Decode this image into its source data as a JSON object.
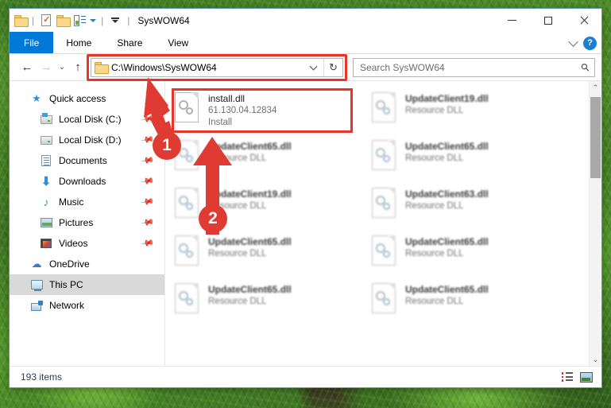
{
  "window": {
    "title": "SysWOW64",
    "quick_access_toolbar": [
      {
        "name": "folder-icon",
        "label": ""
      },
      {
        "name": "properties-icon",
        "label": ""
      },
      {
        "name": "new-folder-icon",
        "label": ""
      },
      {
        "name": "customize-quick-access-icon",
        "label": ""
      },
      {
        "name": "minimize-ribbon-icon",
        "label": ""
      }
    ],
    "controls": {
      "minimize": "Minimize",
      "maximize": "Maximize",
      "close": "Close"
    }
  },
  "ribbon": {
    "tabs": [
      {
        "id": "file",
        "label": "File",
        "active": true
      },
      {
        "id": "home",
        "label": "Home",
        "active": false
      },
      {
        "id": "share",
        "label": "Share",
        "active": false
      },
      {
        "id": "view",
        "label": "View",
        "active": false
      }
    ],
    "expand_label": "Expand the Ribbon",
    "help_label": "?"
  },
  "navigation": {
    "back": "←",
    "forward": "→",
    "recent": "⌄",
    "up": "↑"
  },
  "address_bar": {
    "path": "C:\\Windows\\SysWOW64",
    "refresh": "↻",
    "dropdown": "⌄",
    "highlighted": true
  },
  "search": {
    "placeholder": "Search SysWOW64",
    "icon": "search-icon"
  },
  "sidebar": {
    "items": [
      {
        "label": "Quick access",
        "icon": "star-icon",
        "indent": false,
        "pinned": false,
        "selected": false
      },
      {
        "label": "Local Disk (C:)",
        "icon": "drive-icon",
        "indent": true,
        "pinned": true,
        "selected": false
      },
      {
        "label": "Local Disk (D:)",
        "icon": "drive-icon",
        "indent": true,
        "pinned": true,
        "selected": false
      },
      {
        "label": "Documents",
        "icon": "documents-icon",
        "indent": true,
        "pinned": true,
        "selected": false
      },
      {
        "label": "Downloads",
        "icon": "downloads-icon",
        "indent": true,
        "pinned": true,
        "selected": false
      },
      {
        "label": "Music",
        "icon": "music-icon",
        "indent": true,
        "pinned": true,
        "selected": false
      },
      {
        "label": "Pictures",
        "icon": "pictures-icon",
        "indent": true,
        "pinned": true,
        "selected": false
      },
      {
        "label": "Videos",
        "icon": "videos-icon",
        "indent": true,
        "pinned": true,
        "selected": false
      },
      {
        "label": "OneDrive",
        "icon": "cloud-icon",
        "indent": false,
        "pinned": false,
        "selected": false
      },
      {
        "label": "This PC",
        "icon": "this-pc-icon",
        "indent": false,
        "pinned": false,
        "selected": true
      },
      {
        "label": "Network",
        "icon": "network-icon",
        "indent": false,
        "pinned": false,
        "selected": false
      }
    ]
  },
  "files": [
    {
      "name": "install.dll",
      "version": "61.130.04.12834",
      "type": "Install",
      "selected": true,
      "blurred": false
    },
    {
      "name": "UpdateClient19.dll",
      "version": "",
      "type": "Resource DLL",
      "selected": false,
      "blurred": true
    },
    {
      "name": "UpdateClient65.dll",
      "version": "",
      "type": "Resource DLL",
      "selected": false,
      "blurred": true
    },
    {
      "name": "UpdateClient65.dll",
      "version": "",
      "type": "Resource DLL",
      "selected": false,
      "blurred": true
    },
    {
      "name": "UpdateClient19.dll",
      "version": "",
      "type": "Resource DLL",
      "selected": false,
      "blurred": true
    },
    {
      "name": "UpdateClient63.dll",
      "version": "",
      "type": "Resource DLL",
      "selected": false,
      "blurred": true
    },
    {
      "name": "UpdateClient65.dll",
      "version": "",
      "type": "Resource DLL",
      "selected": false,
      "blurred": true
    },
    {
      "name": "UpdateClient65.dll",
      "version": "",
      "type": "Resource DLL",
      "selected": false,
      "blurred": true
    },
    {
      "name": "UpdateClient65.dll",
      "version": "",
      "type": "Resource DLL",
      "selected": false,
      "blurred": true
    },
    {
      "name": "UpdateClient65.dll",
      "version": "",
      "type": "Resource DLL",
      "selected": false,
      "blurred": true
    }
  ],
  "status_bar": {
    "item_count": "193 items",
    "view_details_label": "Details view",
    "view_icons_label": "Large icons view"
  },
  "annotations": {
    "accent_color": "#e03b33",
    "markers": [
      {
        "number": "1",
        "target": "address-bar"
      },
      {
        "number": "2",
        "target": "install-dll-file"
      }
    ]
  },
  "colors": {
    "accent_blue": "#0078d7",
    "annotation_red": "#e03b33",
    "selection_gray": "#d9d9d9",
    "window_border": "#5b96c9"
  }
}
